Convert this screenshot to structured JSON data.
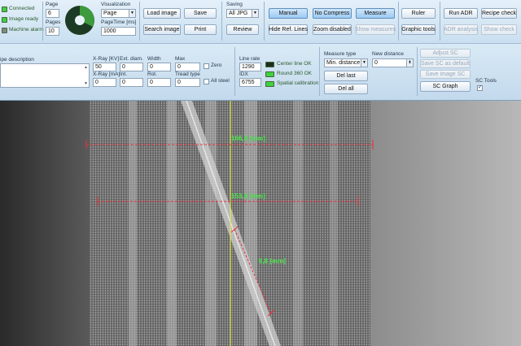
{
  "status": {
    "connected": "Connected",
    "image_ready": "Image ready",
    "machine_alarm": "Machine alarm"
  },
  "page": {
    "page_label": "Page",
    "page_value": "6",
    "pages_label": "Pages",
    "pages_value": "10"
  },
  "visualization": {
    "label": "Visualization",
    "mode_value": "Page",
    "pagetime_label": "PageTime [ms]",
    "pagetime_value": "1000"
  },
  "image_buttons": {
    "load_image": "Load image",
    "save": "Save",
    "search_image": "Search image",
    "print": "Print"
  },
  "saving": {
    "label": "Saving",
    "format_value": "All JPG",
    "review": "Review"
  },
  "mode_buttons": {
    "manual": "Manual",
    "hide_ref_lines": "Hide Ref. Lines",
    "no_compress": "No Compress",
    "zoom_disabled": "Zoom disabled",
    "measure": "Measure",
    "show_measures": "Show measures"
  },
  "tool_buttons": {
    "ruler": "Ruler",
    "graphic_tools": "Graphic tools"
  },
  "adr_buttons": {
    "run_adr": "Run ADR",
    "recipe_check": "Recipe check",
    "adr_analysis": "ADR analysis",
    "show_check": "Show check"
  },
  "recipe": {
    "description_label": "ipe description"
  },
  "xray": {
    "kv_label": "X-Ray [KV]",
    "kv_value": "50",
    "ma_label": "X-Ray [mA]",
    "ma_value": "0",
    "ext_diam_label": "Ext. diam.",
    "ext_diam_value": "0",
    "int_label": "Int.",
    "int_value": "0",
    "width_label": "Width",
    "width_value": "0",
    "rot_label": "Rot.",
    "rot_value": "0",
    "max_label": "Max",
    "max_value": "0",
    "tread_type_label": "Tread type",
    "tread_type_value": "0",
    "zero_label": "Zero",
    "all_steel_label": "All steel"
  },
  "line": {
    "line_rate_label": "Line rate",
    "line_rate_value": "1290",
    "idx_label": "IDX",
    "idx_value": "6755",
    "center_line_ok": "Center line OK",
    "round_360_ok": "Round 360 OK",
    "spatial_calibration": "Spatial calibration"
  },
  "measure": {
    "type_label": "Measure type",
    "type_value": "Min. distance",
    "new_distance_label": "New distance",
    "new_distance_value": "0",
    "del_last": "Del last",
    "del_all": "Del all"
  },
  "sc": {
    "adjust_sc": "Adjust SC",
    "save_sc_default": "Save SC as default",
    "save_image_sc": "Save image SC",
    "sc_graph": "SC Graph",
    "sc_tools_label": "SC Tools",
    "sc_tools_checked": "✓"
  },
  "measurements": [
    {
      "label": "166,9 [mm]"
    },
    {
      "label": "153,6 [mm]"
    },
    {
      "label": "6,8 [mm]"
    }
  ],
  "colors": {
    "measure_line": "#e8323a",
    "measure_text": "#47e84a",
    "center_line": "#e6e64a",
    "accent_button": "#9ccaf2"
  }
}
